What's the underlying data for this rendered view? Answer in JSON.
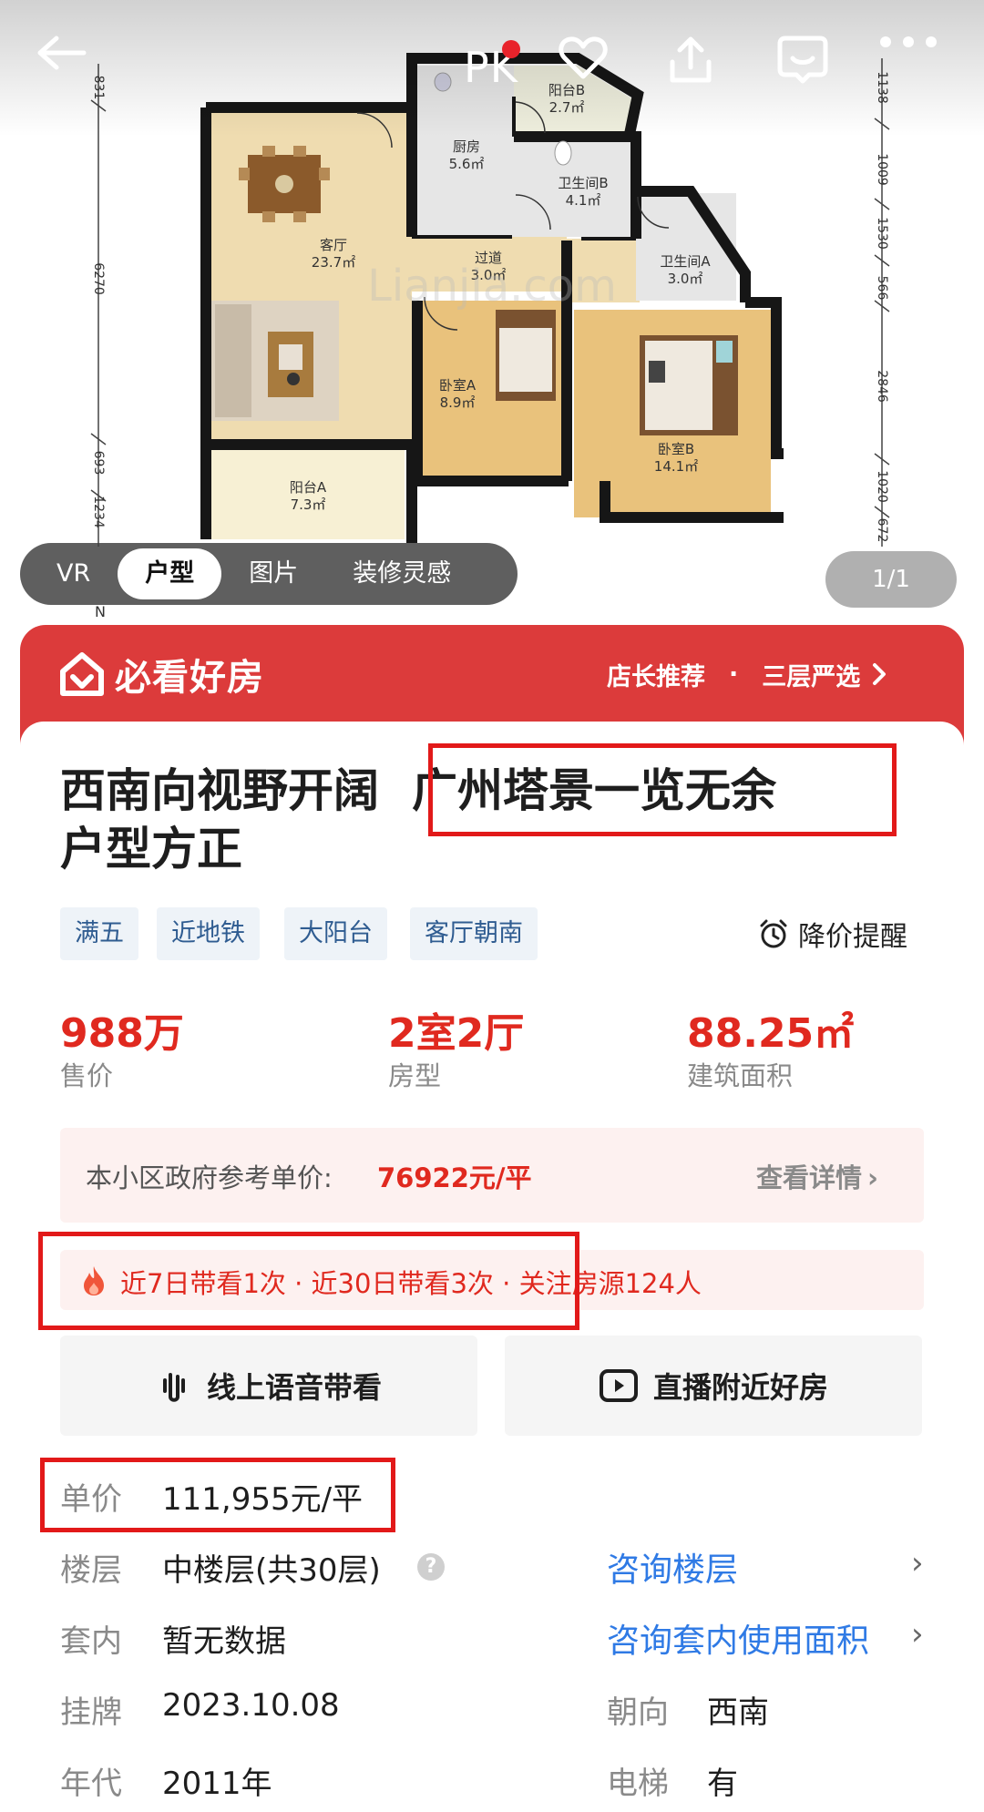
{
  "top_bar": {
    "pk_label": "PK"
  },
  "floor_plan": {
    "rooms": [
      {
        "name": "阳台B",
        "area": "2.7㎡"
      },
      {
        "name": "厨房",
        "area": "5.6㎡"
      },
      {
        "name": "卫生间B",
        "area": "4.1㎡"
      },
      {
        "name": "客厅",
        "area": "23.7㎡"
      },
      {
        "name": "过道",
        "area": "3.0㎡"
      },
      {
        "name": "卫生间A",
        "area": "3.0㎡"
      },
      {
        "name": "卧室A",
        "area": "8.9㎡"
      },
      {
        "name": "卧室B",
        "area": "14.1㎡"
      },
      {
        "name": "阳台A",
        "area": "7.3㎡"
      }
    ],
    "dims_left": [
      "831",
      "6270",
      "693",
      "1234"
    ],
    "dims_right": [
      "1138",
      "1009",
      "1530",
      "566",
      "2846",
      "1020",
      "672"
    ],
    "watermark": "Lianjia.com"
  },
  "media_tabs": [
    "VR",
    "户型",
    "图片",
    "装修灵感"
  ],
  "media_counter": "1/1",
  "banner": {
    "title": "必看好房",
    "link1": "店长推荐",
    "sep": "·",
    "link2": "三层严选"
  },
  "listing": {
    "title_line1": "西南向视野开阔",
    "title_line1b": "广州塔景一览无余",
    "title_line2": "户型方正",
    "tags": [
      "满五",
      "近地铁",
      "大阳台",
      "客厅朝南"
    ],
    "price_alert": "降价提醒"
  },
  "kpis": [
    {
      "value": "988万",
      "label": "售价"
    },
    {
      "value": "2室2厅",
      "label": "房型"
    },
    {
      "value": "88.25㎡",
      "label": "建筑面积"
    }
  ],
  "reference_price": {
    "label": "本小区政府参考单价:",
    "value": "76922元/平",
    "link": "查看详情"
  },
  "activity": {
    "text": "近7日带看1次 · 近30日带看3次 · 关注房源124人"
  },
  "actions": [
    {
      "label": "线上语音带看"
    },
    {
      "label": "直播附近好房"
    }
  ],
  "details": {
    "unit_price": {
      "label": "单价",
      "value": "111,955元/平"
    },
    "floor": {
      "label": "楼层",
      "value": "中楼层(共30层)",
      "link": "咨询楼层"
    },
    "inner": {
      "label": "套内",
      "value": "暂无数据",
      "link": "咨询套内使用面积"
    },
    "listed": {
      "label": "挂牌",
      "value": "2023.10.08"
    },
    "orientation": {
      "label": "朝向",
      "value": "西南"
    },
    "year": {
      "label": "年代",
      "value": "2011年"
    },
    "elevator": {
      "label": "电梯",
      "value": "有"
    }
  },
  "colors": {
    "accent_red": "#dc3b3b",
    "price_red": "#e0291f",
    "link_blue": "#2f7ae5",
    "tag_blue": "#2f5c91"
  }
}
